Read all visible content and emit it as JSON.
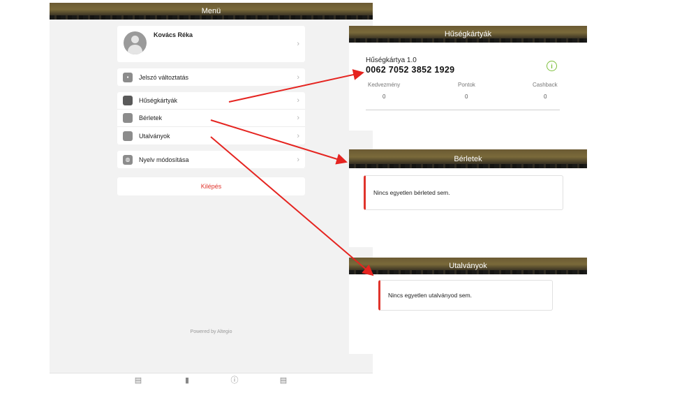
{
  "menu": {
    "title": "Menü",
    "user_name": "Kovács Réka",
    "password_label": "Jelszó változtatás",
    "loyalty_label": "Hűségkártyák",
    "passes_label": "Bérletek",
    "vouchers_label": "Utalványok",
    "language_label": "Nyelv módosítása",
    "logout_label": "Kilépés",
    "powered_by": "Powered by Altegio"
  },
  "loyalty": {
    "title": "Hűségkártyák",
    "card_name": "Hűségkártya 1.0",
    "card_number": "0062 7052 3852 1929",
    "discount_label": "Kedvezmény",
    "points_label": "Pontok",
    "cashback_label": "Cashback",
    "discount_value": "0",
    "points_value": "0",
    "cashback_value": "0"
  },
  "passes": {
    "title": "Bérletek",
    "empty_text": "Nincs egyetlen bérleted sem."
  },
  "vouchers": {
    "title": "Utalványok",
    "empty_text": "Nincs egyetlen utalványod sem."
  },
  "colors": {
    "accent_red": "#e0342c",
    "info_green": "#7cbf3a",
    "arrow_red": "#e52420"
  },
  "icons": {
    "lock": "lock-icon",
    "folder": "folder-icon",
    "globe": "globe-icon",
    "chevron": "chevron-right-icon",
    "info": "info-icon"
  }
}
